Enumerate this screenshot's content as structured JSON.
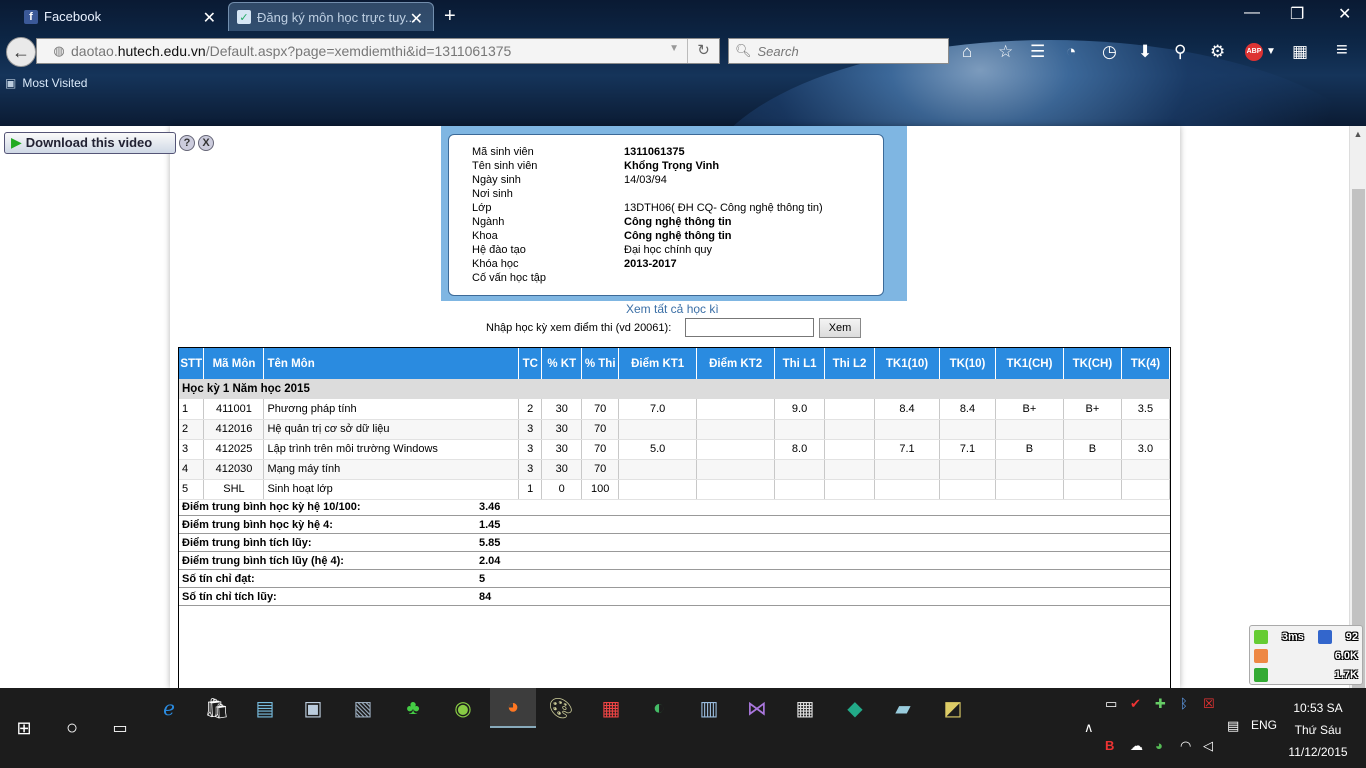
{
  "browser": {
    "tabs": [
      {
        "title": "Facebook",
        "icon": "facebook-icon"
      },
      {
        "title": "Đăng ký môn học trực tuy...",
        "icon": "site-favicon"
      }
    ],
    "url_prefix": "daotao.",
    "url_host": "hutech.edu.vn",
    "url_path": "/Default.aspx?page=xemdiemthi&id=1311061375",
    "search_placeholder": "Search",
    "bookmark": "Most Visited"
  },
  "download_widget": {
    "label": "Download this video",
    "help": "?",
    "close": "X"
  },
  "student": {
    "rows": [
      {
        "label": "Mã sinh viên",
        "value": "1311061375",
        "bold": true
      },
      {
        "label": "Tên sinh viên",
        "value": "Khổng Trọng Vinh",
        "bold": true
      },
      {
        "label": "Ngày sinh",
        "value": "14/03/94",
        "bold": false
      },
      {
        "label": "Nơi sinh",
        "value": "",
        "bold": false
      },
      {
        "label": "Lớp",
        "value": "13DTH06( ĐH CQ- Công nghệ thông tin)",
        "bold": false
      },
      {
        "label": "Ngành",
        "value": "Công nghệ thông tin",
        "bold": true
      },
      {
        "label": "Khoa",
        "value": "Công nghệ thông tin",
        "bold": true
      },
      {
        "label": "Hệ đào tạo",
        "value": "Đại học chính quy",
        "bold": false
      },
      {
        "label": "Khóa học",
        "value": "2013-2017",
        "bold": true
      },
      {
        "label": "Cố vấn học tập",
        "value": "",
        "bold": false
      }
    ]
  },
  "view_all_link": "Xem tất cả học kì",
  "term_filter": {
    "label": "Nhập học kỳ xem điểm thi (vd 20061):",
    "value": "",
    "button": "Xem"
  },
  "table": {
    "headers": [
      "STT",
      "Mã Môn",
      "Tên Môn",
      "TC",
      "% KT",
      "% Thi",
      "Điểm KT1",
      "Điểm KT2",
      "Thi L1",
      "Thi L2",
      "TK1(10)",
      "TK(10)",
      "TK1(CH)",
      "TK(CH)",
      "TK(4)"
    ],
    "term_title": "Học kỳ 1 Năm học 2015",
    "rows": [
      [
        "1",
        "411001",
        "Phương pháp tính",
        "2",
        "30",
        "70",
        "7.0",
        "",
        "9.0",
        "",
        "8.4",
        "8.4",
        "B+",
        "B+",
        "3.5"
      ],
      [
        "2",
        "412016",
        "Hệ quản trị cơ sở dữ liệu",
        "3",
        "30",
        "70",
        "",
        "",
        "",
        "",
        "",
        "",
        "",
        "",
        ""
      ],
      [
        "3",
        "412025",
        "Lập trình trên môi trường Windows",
        "3",
        "30",
        "70",
        "5.0",
        "",
        "8.0",
        "",
        "7.1",
        "7.1",
        "B",
        "B",
        "3.0"
      ],
      [
        "4",
        "412030",
        "Mạng máy tính",
        "3",
        "30",
        "70",
        "",
        "",
        "",
        "",
        "",
        "",
        "",
        "",
        ""
      ],
      [
        "5",
        "SHL",
        "Sinh hoạt lớp",
        "1",
        "0",
        "100",
        "",
        "",
        "",
        "",
        "",
        "",
        "",
        "",
        ""
      ]
    ],
    "summary": [
      {
        "label": "Điểm trung bình học kỳ hệ 10/100:",
        "value": "3.46"
      },
      {
        "label": "Điểm trung bình học kỳ hệ 4:",
        "value": "1.45"
      },
      {
        "label": "Điểm trung bình tích lũy:",
        "value": "5.85"
      },
      {
        "label": "Điểm trung bình tích lũy (hệ 4):",
        "value": "2.04"
      },
      {
        "label": "Số tín chỉ đạt:",
        "value": "5"
      },
      {
        "label": "Số tín chỉ tích lũy:",
        "value": "84"
      }
    ]
  },
  "netmeter": {
    "ping": "3ms",
    "count": "92",
    "down": "6.0K",
    "up": "1.7K"
  },
  "taskbar": {
    "time": "10:53 SA",
    "day": "Thứ Sáu",
    "date": "11/12/2015",
    "lang": "ENG"
  },
  "colors": {
    "header_blue": "#2a8be0",
    "info_box_blue": "#7fb6e2",
    "link_blue": "#3b6fa6"
  }
}
